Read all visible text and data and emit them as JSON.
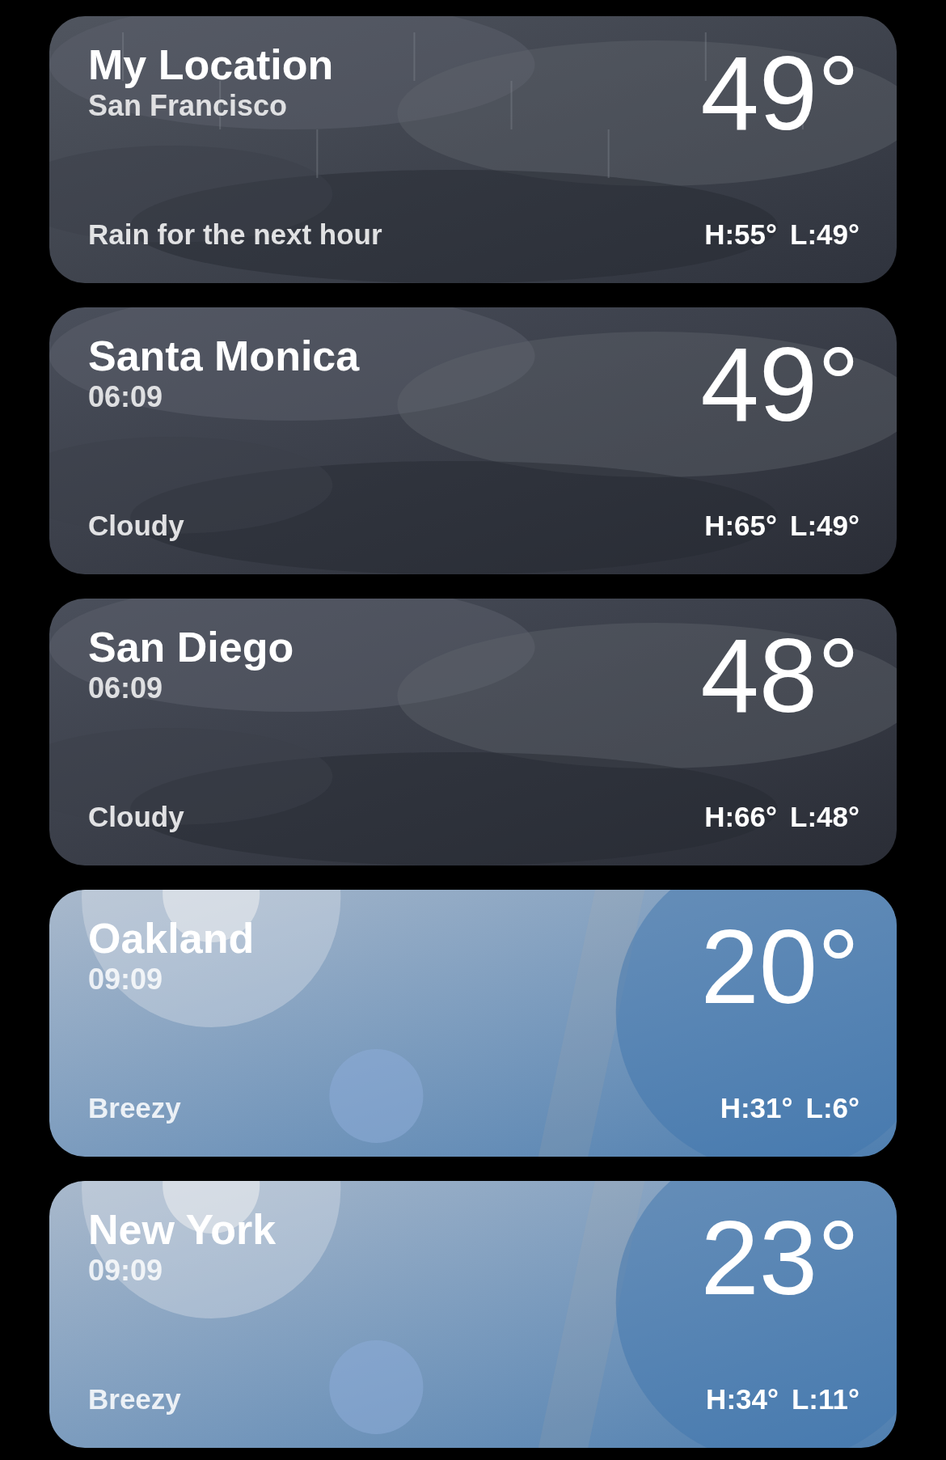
{
  "locations": [
    {
      "kind": "rain",
      "name": "My Location",
      "subtitle": "San Francisco",
      "temperature": "49°",
      "condition": "Rain for the next hour",
      "high": "H:55°",
      "low": "L:49°"
    },
    {
      "kind": "cloudy",
      "name": "Santa Monica",
      "subtitle": "06:09",
      "temperature": "49°",
      "condition": "Cloudy",
      "high": "H:65°",
      "low": "L:49°"
    },
    {
      "kind": "cloudy",
      "name": "San Diego",
      "subtitle": "06:09",
      "temperature": "48°",
      "condition": "Cloudy",
      "high": "H:66°",
      "low": "L:48°"
    },
    {
      "kind": "clear",
      "name": "Oakland",
      "subtitle": "09:09",
      "temperature": "20°",
      "condition": "Breezy",
      "high": "H:31°",
      "low": "L:6°"
    },
    {
      "kind": "clear",
      "name": "New York",
      "subtitle": "09:09",
      "temperature": "23°",
      "condition": "Breezy",
      "high": "H:34°",
      "low": "L:11°"
    }
  ]
}
